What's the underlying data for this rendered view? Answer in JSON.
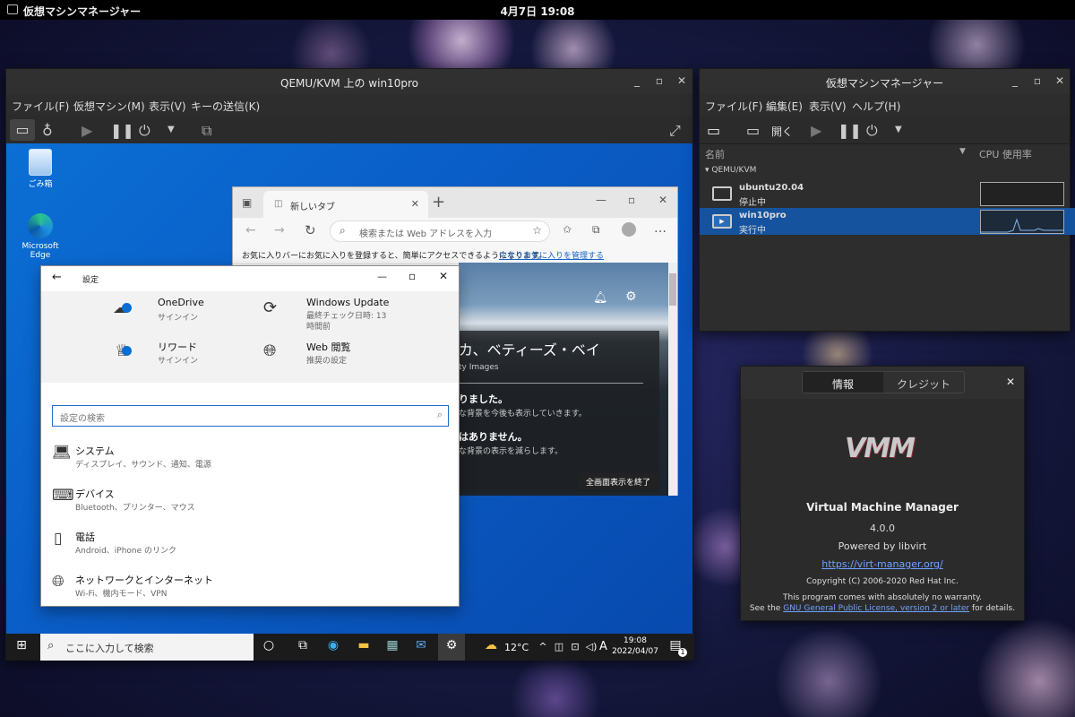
{
  "topbar": {
    "app_title": "仮想マシンマネージャー",
    "clock": "4月7日  19:08"
  },
  "console": {
    "title": "QEMU/KVM 上の win10pro",
    "menu": [
      "ファイル(F)",
      "仮想マシン(M)",
      "表示(V)",
      "キーの送信(K)"
    ],
    "toolbar_icons": [
      "monitor-icon",
      "bulb-icon",
      "play-icon",
      "pause-icon",
      "power-icon",
      "dropdown-icon",
      "screenshot-icon",
      "fullscreen-icon"
    ]
  },
  "guest": {
    "desktop_icons": [
      {
        "label": "ごみ箱",
        "icon": "recycle-bin-icon"
      },
      {
        "label": "Microsoft Edge",
        "icon": "edge-icon"
      }
    ],
    "taskbar": {
      "search_placeholder": "ここに入力して検索",
      "weather": "12°C",
      "ime": "A",
      "time": "19:08",
      "date": "2022/04/07",
      "notification_count": "1"
    }
  },
  "edge": {
    "tab_label": "新しいタブ",
    "address_placeholder": "検索または Web アドレスを入力",
    "favorites_msg": "お気に入りバーにお気に入りを登録すると、簡単にアクセスできるようになります。",
    "favorites_link": "今すぐお気に入りを管理する",
    "hero_title": "カ、ベティーズ・ベイ",
    "hero_credit": "ty Images",
    "msg1": "りました。",
    "msg1_sub": "な背景を今後も表示していきます。",
    "msg2": "はありません。",
    "msg2_sub": "な背景の表示を減らします。",
    "fullscreen_exit": "全画面表示を終了"
  },
  "settings": {
    "title": "設定",
    "top_items": [
      {
        "title": "OneDrive",
        "sub": "サインイン",
        "icon": "cloud-icon"
      },
      {
        "title": "Windows Update",
        "sub": "最終チェック日時: 13 時間前",
        "icon": "update-icon"
      },
      {
        "title": "リワード",
        "sub": "サインイン",
        "icon": "rewards-icon"
      },
      {
        "title": "Web 閲覧",
        "sub": "推奨の設定",
        "icon": "globe-icon"
      }
    ],
    "search_placeholder": "設定の検索",
    "items": [
      {
        "title": "システム",
        "sub": "ディスプレイ、サウンド、通知、電源",
        "icon": "laptop-icon"
      },
      {
        "title": "デバイス",
        "sub": "Bluetooth、プリンター、マウス",
        "icon": "keyboard-icon"
      },
      {
        "title": "電話",
        "sub": "Android、iPhone のリンク",
        "icon": "phone-icon"
      },
      {
        "title": "ネットワークとインターネット",
        "sub": "Wi-Fi、機内モード、VPN",
        "icon": "network-globe-icon"
      }
    ]
  },
  "manager": {
    "title": "仮想マシンマネージャー",
    "menu": [
      "ファイル(F)",
      "編集(E)",
      "表示(V)",
      "ヘルプ(H)"
    ],
    "open_label": "開く",
    "columns": {
      "name": "名前",
      "cpu": "CPU 使用率"
    },
    "group": "QEMU/KVM",
    "vms": [
      {
        "name": "ubuntu20.04",
        "status": "停止中",
        "selected": false
      },
      {
        "name": "win10pro",
        "status": "実行中",
        "selected": true
      }
    ]
  },
  "about": {
    "tabs": [
      "情報",
      "クレジット"
    ],
    "logo_text": "VMM",
    "name": "Virtual Machine Manager",
    "version": "4.0.0",
    "powered": "Powered by libvirt",
    "url": "https://virt-manager.org/",
    "copyright": "Copyright (C) 2006-2020 Red Hat Inc.",
    "warranty": "This program comes with absolutely no warranty.",
    "license_pre": "See the ",
    "license_link": "GNU General Public License, version 2 or later",
    "license_post": " for details."
  },
  "colors": {
    "accent": "#3465a4",
    "win_blue": "#0a5ec7",
    "selection": "#15539e"
  }
}
